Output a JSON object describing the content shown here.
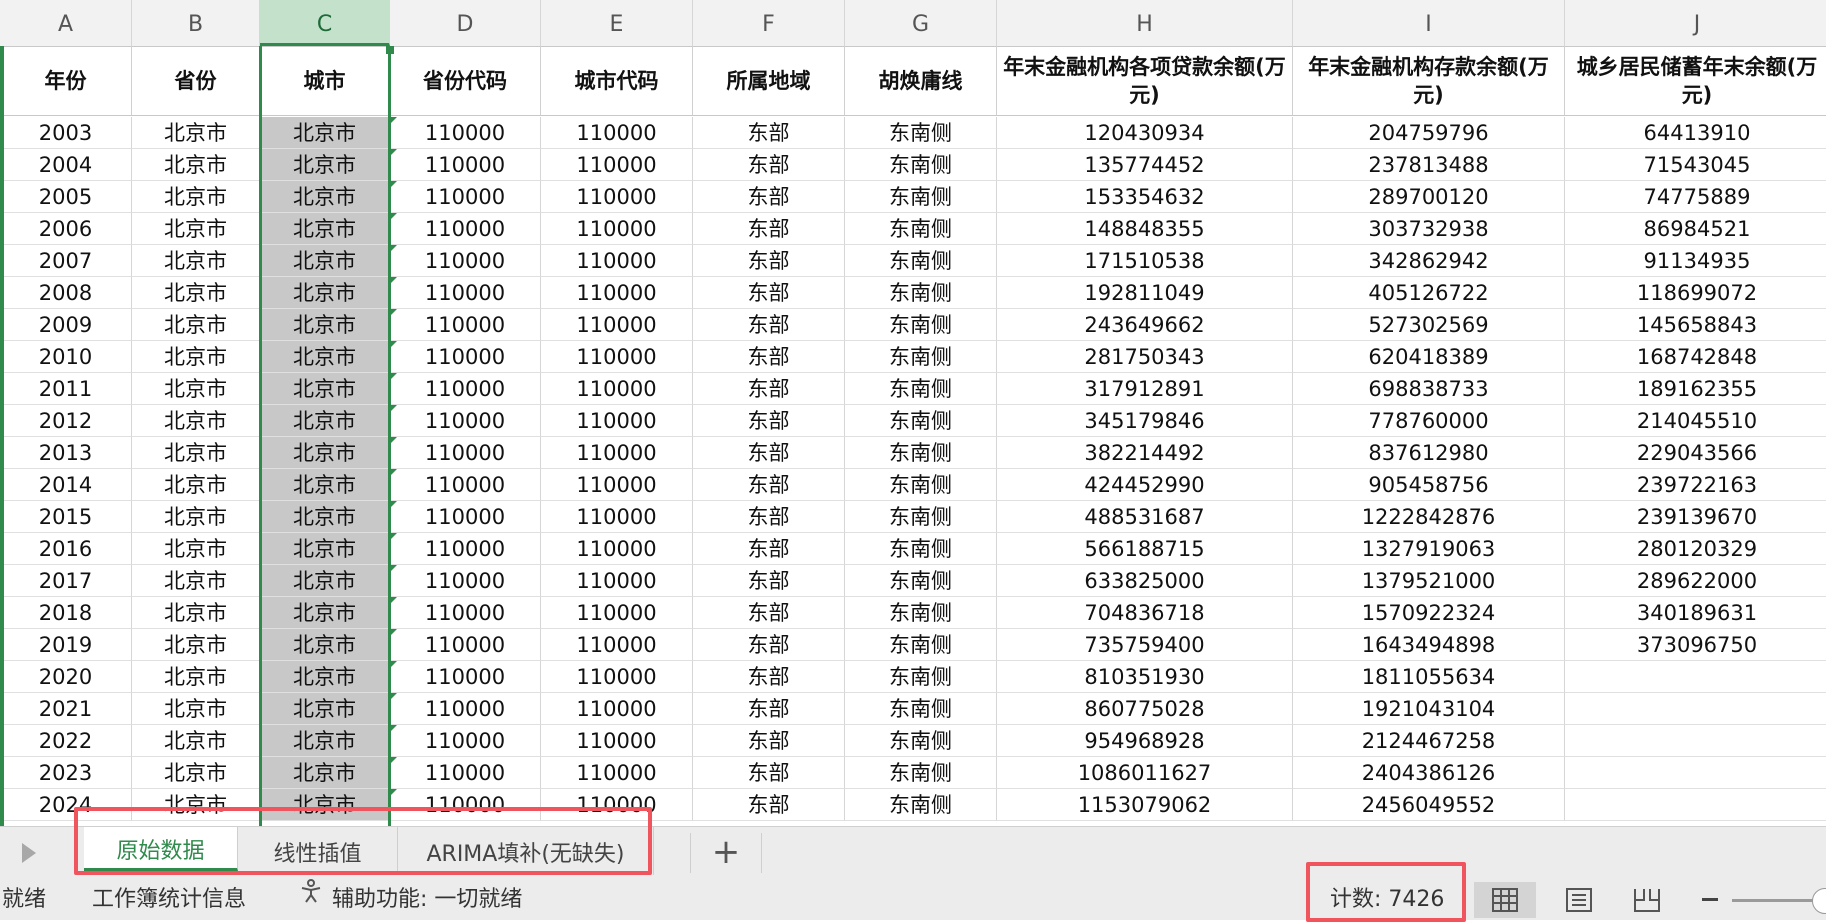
{
  "column_letters": [
    "A",
    "B",
    "C",
    "D",
    "E",
    "F",
    "G",
    "H",
    "I",
    "J"
  ],
  "headers": [
    "年份",
    "省份",
    "城市",
    "省份代码",
    "城市代码",
    "所属地域",
    "胡焕庸线",
    "年末金融机构各项贷款余额(万元)",
    "年末金融机构存款余额(万元)",
    "城乡居民储蓄年末余额(万元)"
  ],
  "rows": [
    [
      "2003",
      "北京市",
      "北京市",
      "110000",
      "110000",
      "东部",
      "东南侧",
      "120430934",
      "204759796",
      "64413910"
    ],
    [
      "2004",
      "北京市",
      "北京市",
      "110000",
      "110000",
      "东部",
      "东南侧",
      "135774452",
      "237813488",
      "71543045"
    ],
    [
      "2005",
      "北京市",
      "北京市",
      "110000",
      "110000",
      "东部",
      "东南侧",
      "153354632",
      "289700120",
      "74775889"
    ],
    [
      "2006",
      "北京市",
      "北京市",
      "110000",
      "110000",
      "东部",
      "东南侧",
      "148848355",
      "303732938",
      "86984521"
    ],
    [
      "2007",
      "北京市",
      "北京市",
      "110000",
      "110000",
      "东部",
      "东南侧",
      "171510538",
      "342862942",
      "91134935"
    ],
    [
      "2008",
      "北京市",
      "北京市",
      "110000",
      "110000",
      "东部",
      "东南侧",
      "192811049",
      "405126722",
      "118699072"
    ],
    [
      "2009",
      "北京市",
      "北京市",
      "110000",
      "110000",
      "东部",
      "东南侧",
      "243649662",
      "527302569",
      "145658843"
    ],
    [
      "2010",
      "北京市",
      "北京市",
      "110000",
      "110000",
      "东部",
      "东南侧",
      "281750343",
      "620418389",
      "168742848"
    ],
    [
      "2011",
      "北京市",
      "北京市",
      "110000",
      "110000",
      "东部",
      "东南侧",
      "317912891",
      "698838733",
      "189162355"
    ],
    [
      "2012",
      "北京市",
      "北京市",
      "110000",
      "110000",
      "东部",
      "东南侧",
      "345179846",
      "778760000",
      "214045510"
    ],
    [
      "2013",
      "北京市",
      "北京市",
      "110000",
      "110000",
      "东部",
      "东南侧",
      "382214492",
      "837612980",
      "229043566"
    ],
    [
      "2014",
      "北京市",
      "北京市",
      "110000",
      "110000",
      "东部",
      "东南侧",
      "424452990",
      "905458756",
      "239722163"
    ],
    [
      "2015",
      "北京市",
      "北京市",
      "110000",
      "110000",
      "东部",
      "东南侧",
      "488531687",
      "1222842876",
      "239139670"
    ],
    [
      "2016",
      "北京市",
      "北京市",
      "110000",
      "110000",
      "东部",
      "东南侧",
      "566188715",
      "1327919063",
      "280120329"
    ],
    [
      "2017",
      "北京市",
      "北京市",
      "110000",
      "110000",
      "东部",
      "东南侧",
      "633825000",
      "1379521000",
      "289622000"
    ],
    [
      "2018",
      "北京市",
      "北京市",
      "110000",
      "110000",
      "东部",
      "东南侧",
      "704836718",
      "1570922324",
      "340189631"
    ],
    [
      "2019",
      "北京市",
      "北京市",
      "110000",
      "110000",
      "东部",
      "东南侧",
      "735759400",
      "1643494898",
      "373096750"
    ],
    [
      "2020",
      "北京市",
      "北京市",
      "110000",
      "110000",
      "东部",
      "东南侧",
      "810351930",
      "1811055634",
      ""
    ],
    [
      "2021",
      "北京市",
      "北京市",
      "110000",
      "110000",
      "东部",
      "东南侧",
      "860775028",
      "1921043104",
      ""
    ],
    [
      "2022",
      "北京市",
      "北京市",
      "110000",
      "110000",
      "东部",
      "东南侧",
      "954968928",
      "2124467258",
      ""
    ],
    [
      "2023",
      "北京市",
      "北京市",
      "110000",
      "110000",
      "东部",
      "东南侧",
      "1086011627",
      "2404386126",
      ""
    ],
    [
      "2024",
      "北京市",
      "北京市",
      "110000",
      "110000",
      "东部",
      "东南侧",
      "1153079062",
      "2456049552",
      ""
    ]
  ],
  "selected_column": "C",
  "sheet_tabs": [
    {
      "label": "原始数据",
      "active": true
    },
    {
      "label": "线性插值",
      "active": false
    },
    {
      "label": "ARIMA填补(无缺失)",
      "active": false
    }
  ],
  "add_sheet_label": "+",
  "status": {
    "ready": "就绪",
    "workbook_stats": "工作簿统计信息",
    "accessibility": "辅助功能: 一切就绪",
    "count": "计数: 7426"
  },
  "colors": {
    "accent": "#2f8a4c",
    "highlight_box": "#f0545c",
    "selected_fill": "#c8c8c8"
  },
  "icons": [
    "sheet-nav-arrow-icon",
    "accessibility-icon",
    "normal-view-icon",
    "page-layout-view-icon",
    "page-break-view-icon",
    "zoom-out-icon"
  ]
}
